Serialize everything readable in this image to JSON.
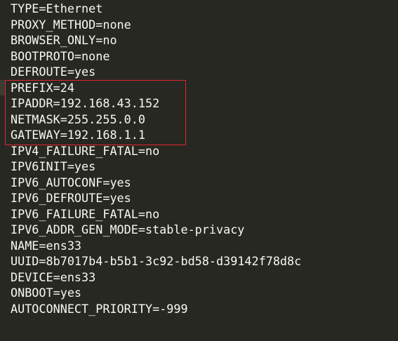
{
  "file_lines": [
    "TYPE=Ethernet",
    "PROXY_METHOD=none",
    "BROWSER_ONLY=no",
    "BOOTPROTO=none",
    "DEFROUTE=yes",
    "PREFIX=24",
    "IPADDR=192.168.43.152",
    "NETMASK=255.255.0.0",
    "GATEWAY=192.168.1.1",
    "IPV4_FAILURE_FATAL=no",
    "IPV6INIT=yes",
    "IPV6_AUTOCONF=yes",
    "IPV6_DEFROUTE=yes",
    "IPV6_FAILURE_FATAL=no",
    "IPV6_ADDR_GEN_MODE=stable-privacy",
    "NAME=ens33",
    "UUID=8b7017b4-b5b1-3c92-bd58-d39142f78d8c",
    "DEVICE=ens33",
    "ONBOOT=yes",
    "AUTOCONNECT_PRIORITY=-999"
  ],
  "colors": {
    "background": "#272822",
    "text": "#f8f8f2",
    "highlight_box": "#e0262e"
  }
}
